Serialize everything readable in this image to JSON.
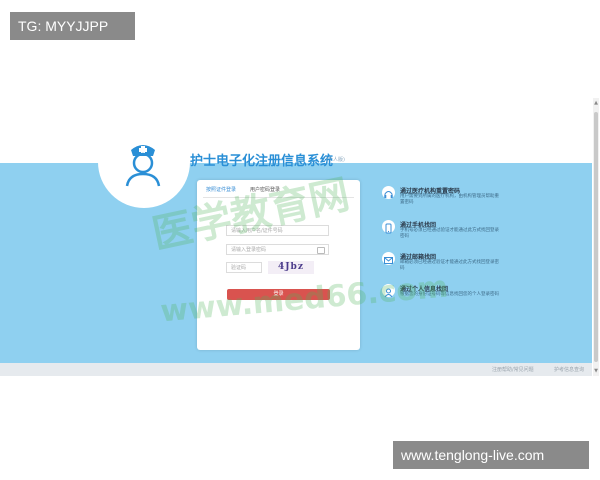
{
  "overlays": {
    "top_left_tag": "TG: MYYJJPP",
    "bottom_right_tag": "www.tenglong-live.com"
  },
  "header": {
    "system_title": "护士电子化注册信息系统",
    "system_subtitle": "(个人版)"
  },
  "login": {
    "tabs": [
      "按照证件登录",
      "用户密码登录"
    ],
    "username_placeholder": "请输入用户名/证件号码",
    "password_placeholder": "请输入登录密码",
    "captcha_placeholder": "验证码",
    "captcha_text": "4Jbz",
    "login_button": "登录"
  },
  "options": [
    {
      "title": "通过医疗机构重置密码",
      "desc": "用户需要到所属的医疗机构，由机构管理员帮助重置密码",
      "icon": "headset-icon"
    },
    {
      "title": "通过手机找回",
      "desc": "手机号必须已经通过验证才能通过此方式找回登录密码",
      "icon": "phone-icon"
    },
    {
      "title": "通过邮箱找回",
      "desc": "邮箱必须已经通过验证才能通过此方式找回登录密码",
      "icon": "mail-icon"
    },
    {
      "title": "通过个人信息找回",
      "desc": "根据您的身份证号码等信息找回您的个人登录密码",
      "icon": "user-icon"
    }
  ],
  "footer": {
    "link1": "注册帮助/常见问题",
    "link2": "护考信息查询"
  },
  "watermark": {
    "line1": "医学教育网",
    "line2": "www.med66.com"
  },
  "colors": {
    "band": "#8fd0f0",
    "title": "#2a8fd6",
    "button": "#d9534f"
  }
}
